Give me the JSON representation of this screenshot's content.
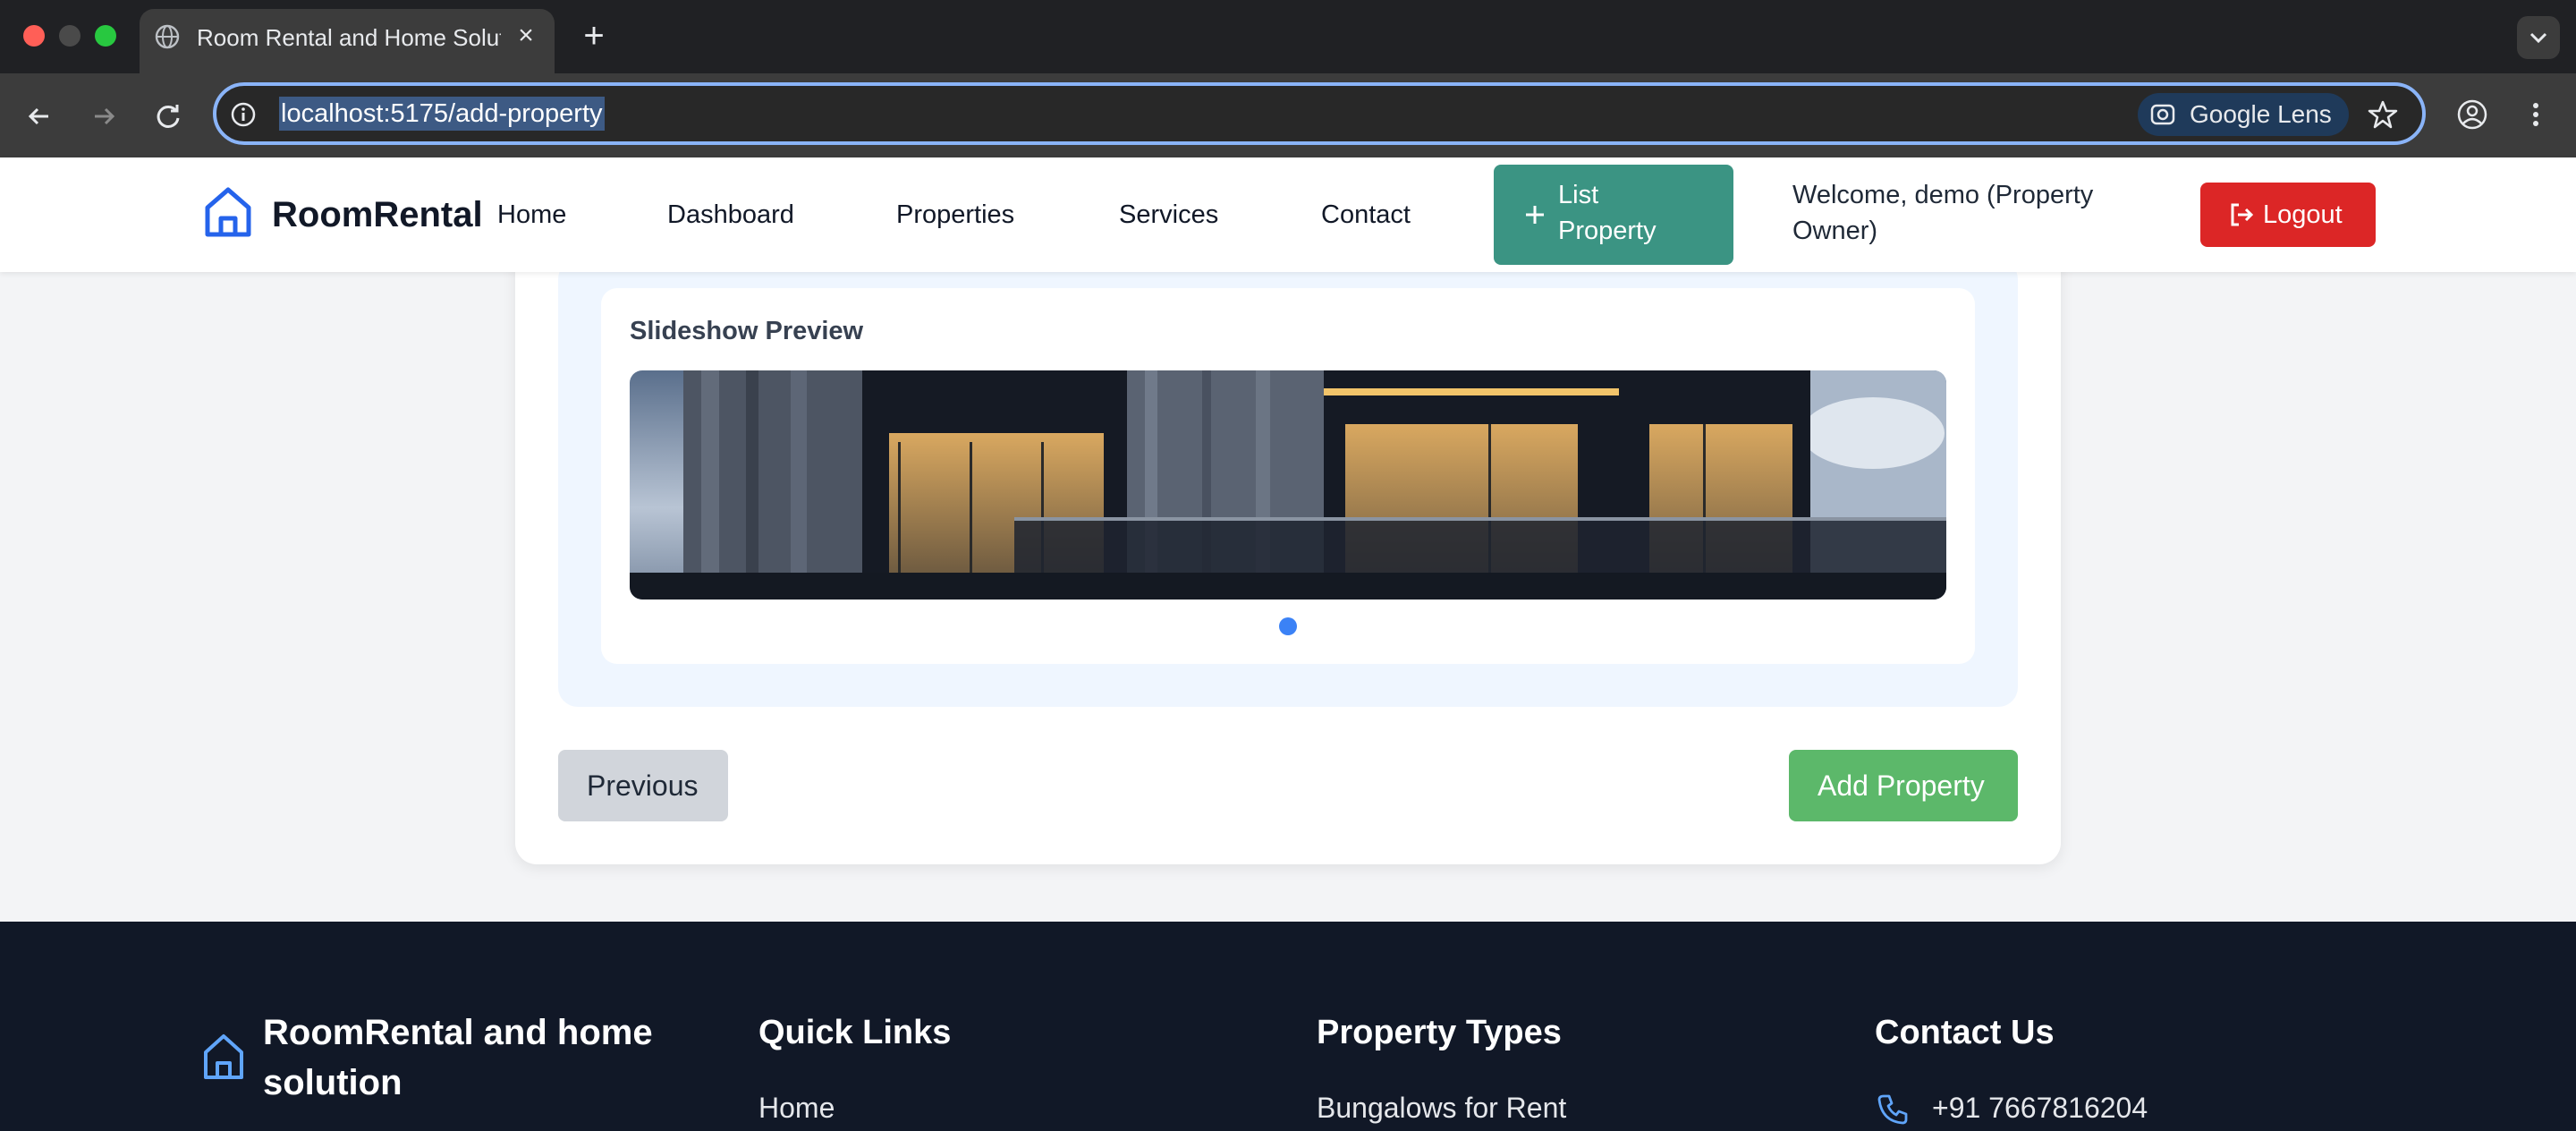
{
  "browser": {
    "tab_title": "Room Rental and Home Solution",
    "url": "localhost:5175/add-property",
    "lens_label": "Google Lens"
  },
  "header": {
    "brand": "RoomRental",
    "nav": [
      "Home",
      "Dashboard",
      "Properties",
      "Services",
      "Contact"
    ],
    "list_property": "List Property",
    "welcome": "Welcome, demo (Property Owner)",
    "logout": "Logout"
  },
  "form": {
    "preview_title": "Slideshow Preview",
    "slide_count": 1,
    "active_slide": 1,
    "previous_label": "Previous",
    "submit_label": "Add Property"
  },
  "footer": {
    "brand": "RoomRental and home solution",
    "quick_links_title": "Quick Links",
    "quick_links": [
      "Home"
    ],
    "property_types_title": "Property Types",
    "property_types": [
      "Bungalows for Rent"
    ],
    "contact_title": "Contact Us",
    "phone": "+91 7667816204"
  },
  "colors": {
    "accent": "#3b9483",
    "danger": "#dc2626",
    "success": "#5cb86a",
    "primary": "#3b82f6",
    "footer_bg": "#111827"
  },
  "icons": [
    "globe-icon",
    "back-icon",
    "forward-icon",
    "reload-icon",
    "info-icon",
    "lens-icon",
    "star-icon",
    "profile-icon",
    "more-icon",
    "home-icon",
    "plus-icon",
    "logout-icon",
    "phone-icon"
  ]
}
